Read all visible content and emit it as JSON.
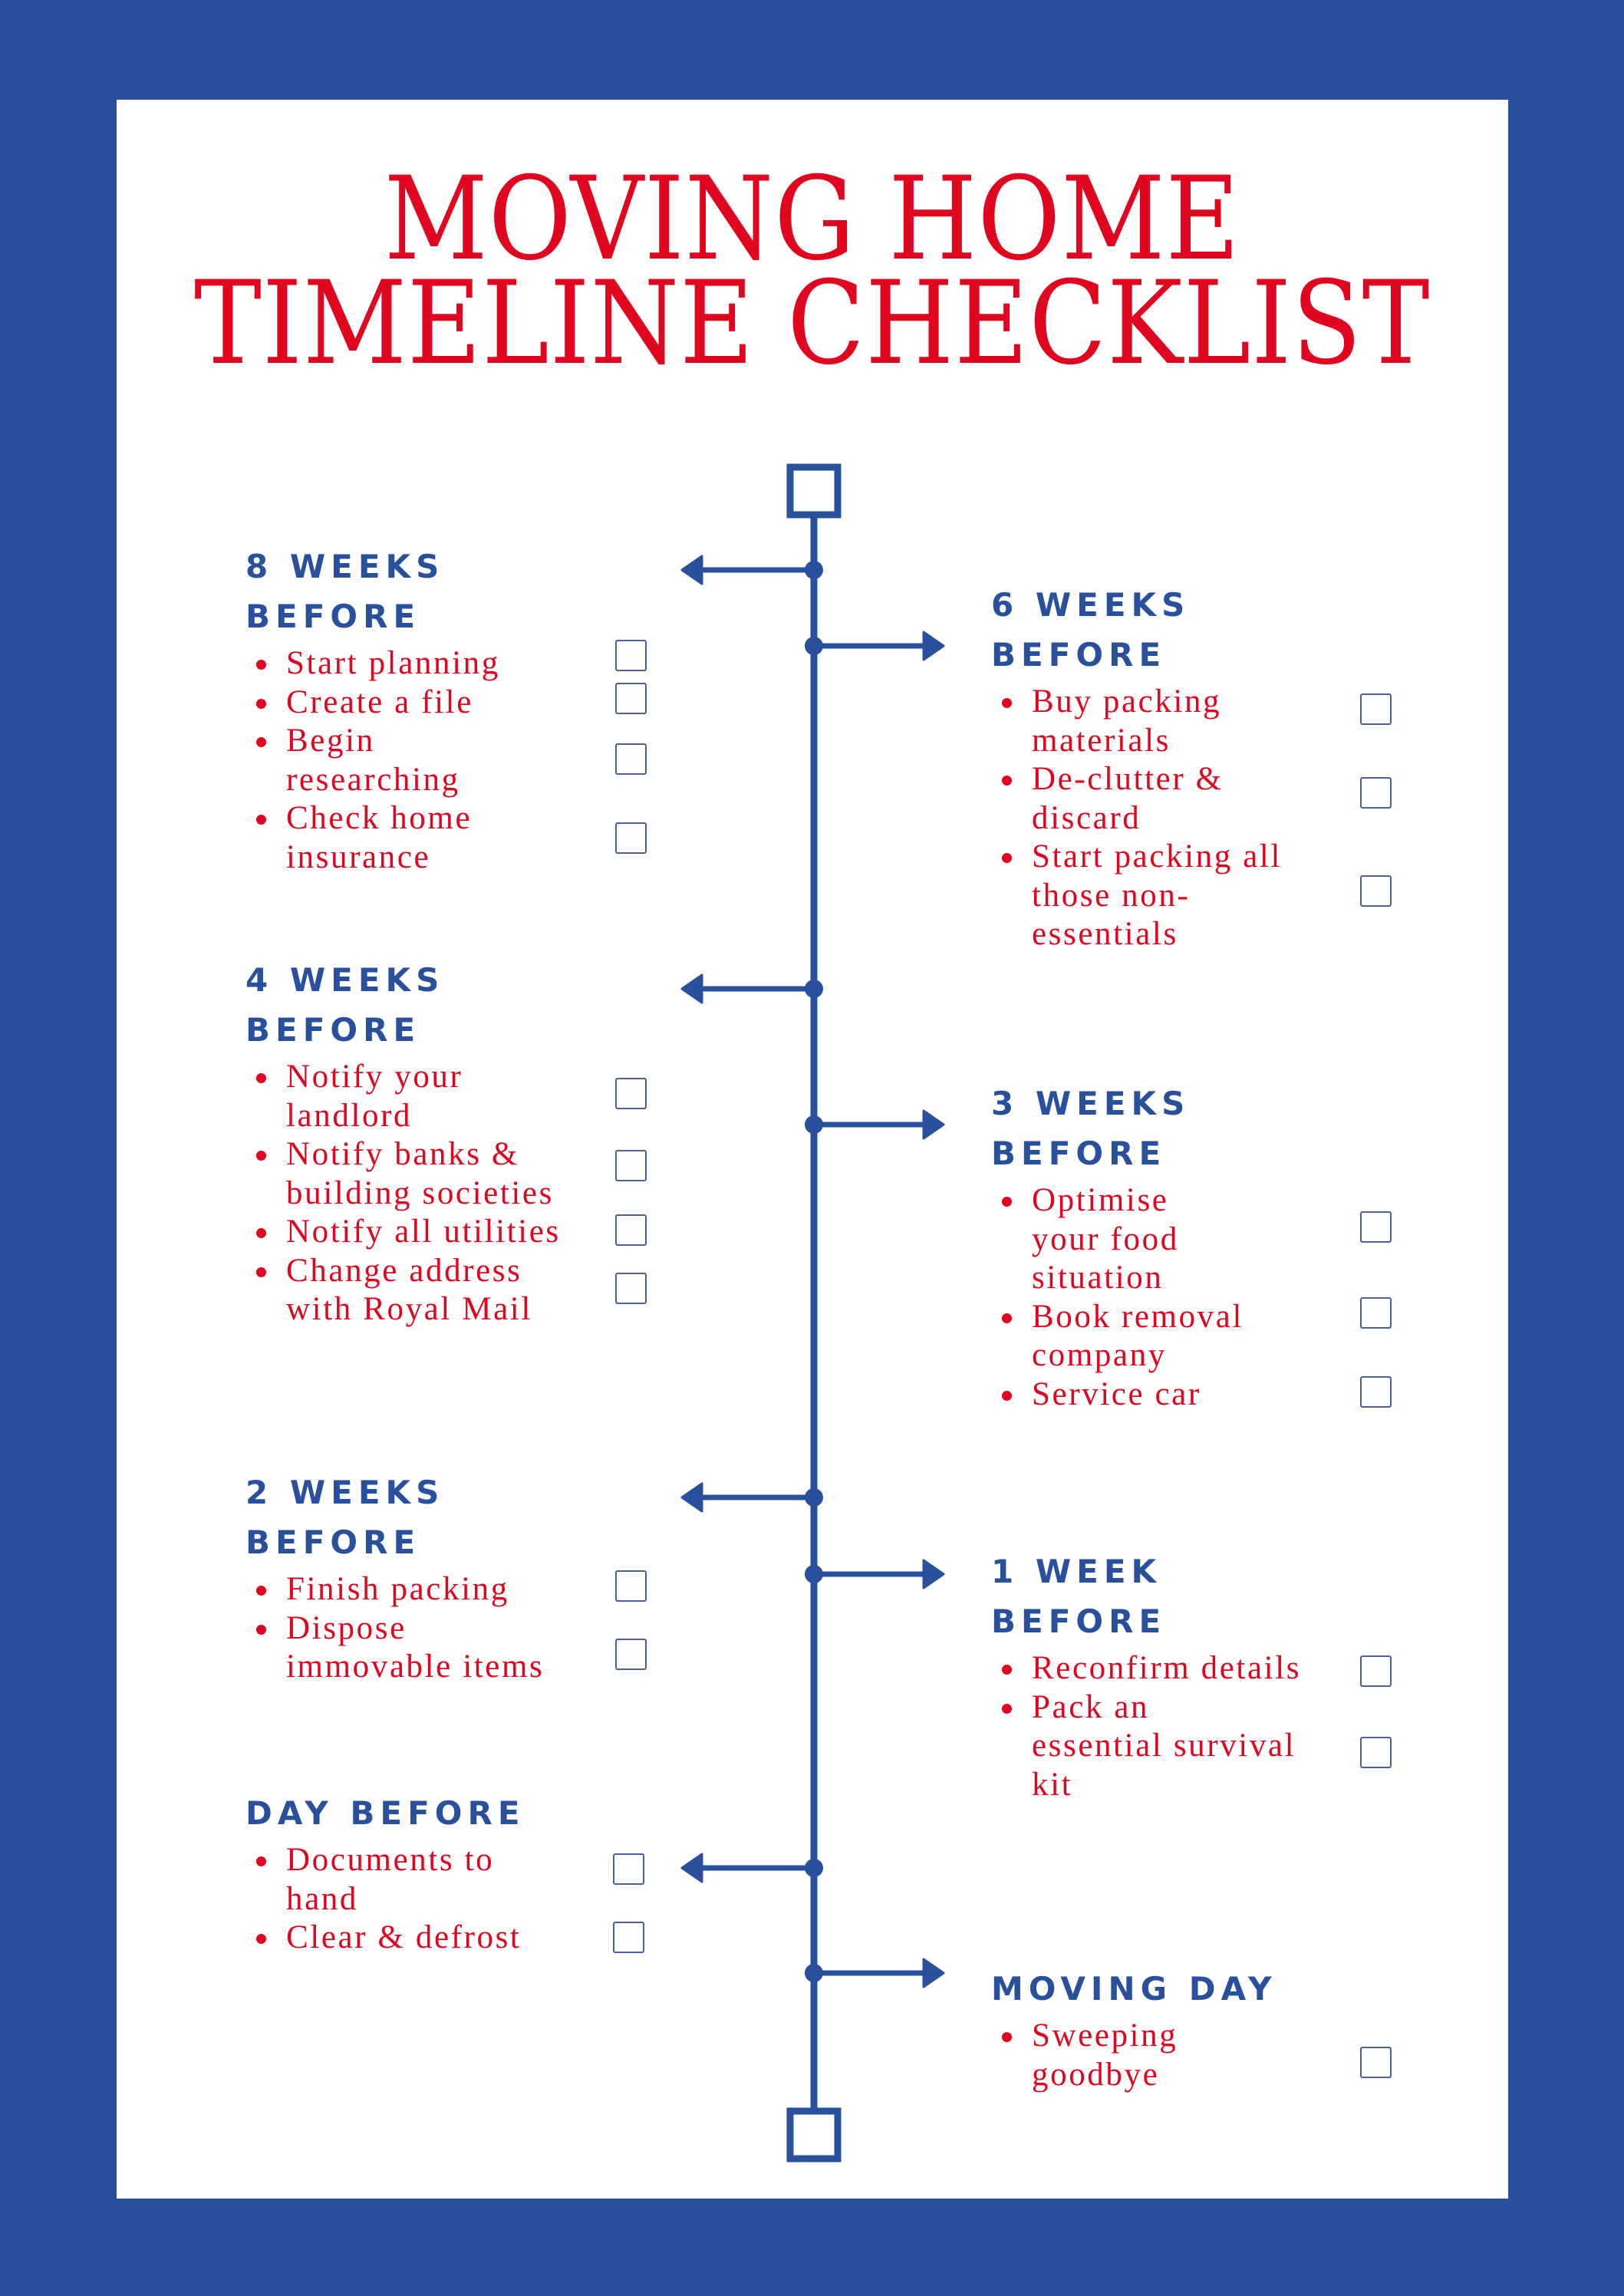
{
  "title": {
    "line1": "MOVING HOME",
    "line2": "TIMELINE CHECKLIST"
  },
  "colors": {
    "border_blue": "#29509C",
    "heading_blue": "#29509C",
    "item_red": "#E0061F",
    "checkbox_border": "#4A5F9C",
    "panel": "#FFFFFF"
  },
  "timeline": {
    "start_marker": "square-outline-icon",
    "end_marker": "square-outline-icon",
    "branch_icon": "arrow-icon"
  },
  "sections": [
    {
      "heading": "8 WEEKS\nBEFORE",
      "side": "left",
      "items": [
        {
          "text": "Start planning",
          "checked": false
        },
        {
          "text": "Create a file",
          "checked": false
        },
        {
          "text": " Begin\nresearching",
          "checked": false
        },
        {
          "text": "Check home\ninsurance",
          "checked": false
        }
      ]
    },
    {
      "heading": "6 WEEKS\nBEFORE",
      "side": "right",
      "items": [
        {
          "text": "Buy packing\nmaterials",
          "checked": false
        },
        {
          "text": "De-clutter &\ndiscard",
          "checked": false
        },
        {
          "text": "Start packing all\nthose non-\nessentials",
          "checked": false
        }
      ]
    },
    {
      "heading": "4 WEEKS\nBEFORE",
      "side": "left",
      "items": [
        {
          "text": "Notify your\nlandlord",
          "checked": false
        },
        {
          "text": "Notify banks &\nbuilding societies",
          "checked": false
        },
        {
          "text": "Notify all utilities",
          "checked": false
        },
        {
          "text": "Change address\nwith Royal Mail",
          "checked": false
        }
      ]
    },
    {
      "heading": "3 WEEKS\nBEFORE",
      "side": "right",
      "items": [
        {
          "text": "Optimise\nyour food\nsituation",
          "checked": false
        },
        {
          "text": "Book removal\ncompany",
          "checked": false
        },
        {
          "text": "Service car",
          "checked": false
        }
      ]
    },
    {
      "heading": "2 WEEKS\nBEFORE",
      "side": "left",
      "items": [
        {
          "text": "Finish packing",
          "checked": false
        },
        {
          "text": "Dispose\nimmovable items",
          "checked": false
        }
      ]
    },
    {
      "heading": "1 WEEK\nBEFORE",
      "side": "right",
      "items": [
        {
          "text": "Reconfirm details",
          "checked": false
        },
        {
          "text": "Pack an\nessential survival\nkit",
          "checked": false
        }
      ]
    },
    {
      "heading": "DAY BEFORE",
      "side": "left",
      "items": [
        {
          "text": "Documents to\nhand",
          "checked": false
        },
        {
          "text": "Clear & defrost",
          "checked": false
        }
      ]
    },
    {
      "heading": "MOVING DAY",
      "side": "right",
      "items": [
        {
          "text": "Sweeping\ngoodbye",
          "checked": false
        }
      ]
    }
  ]
}
